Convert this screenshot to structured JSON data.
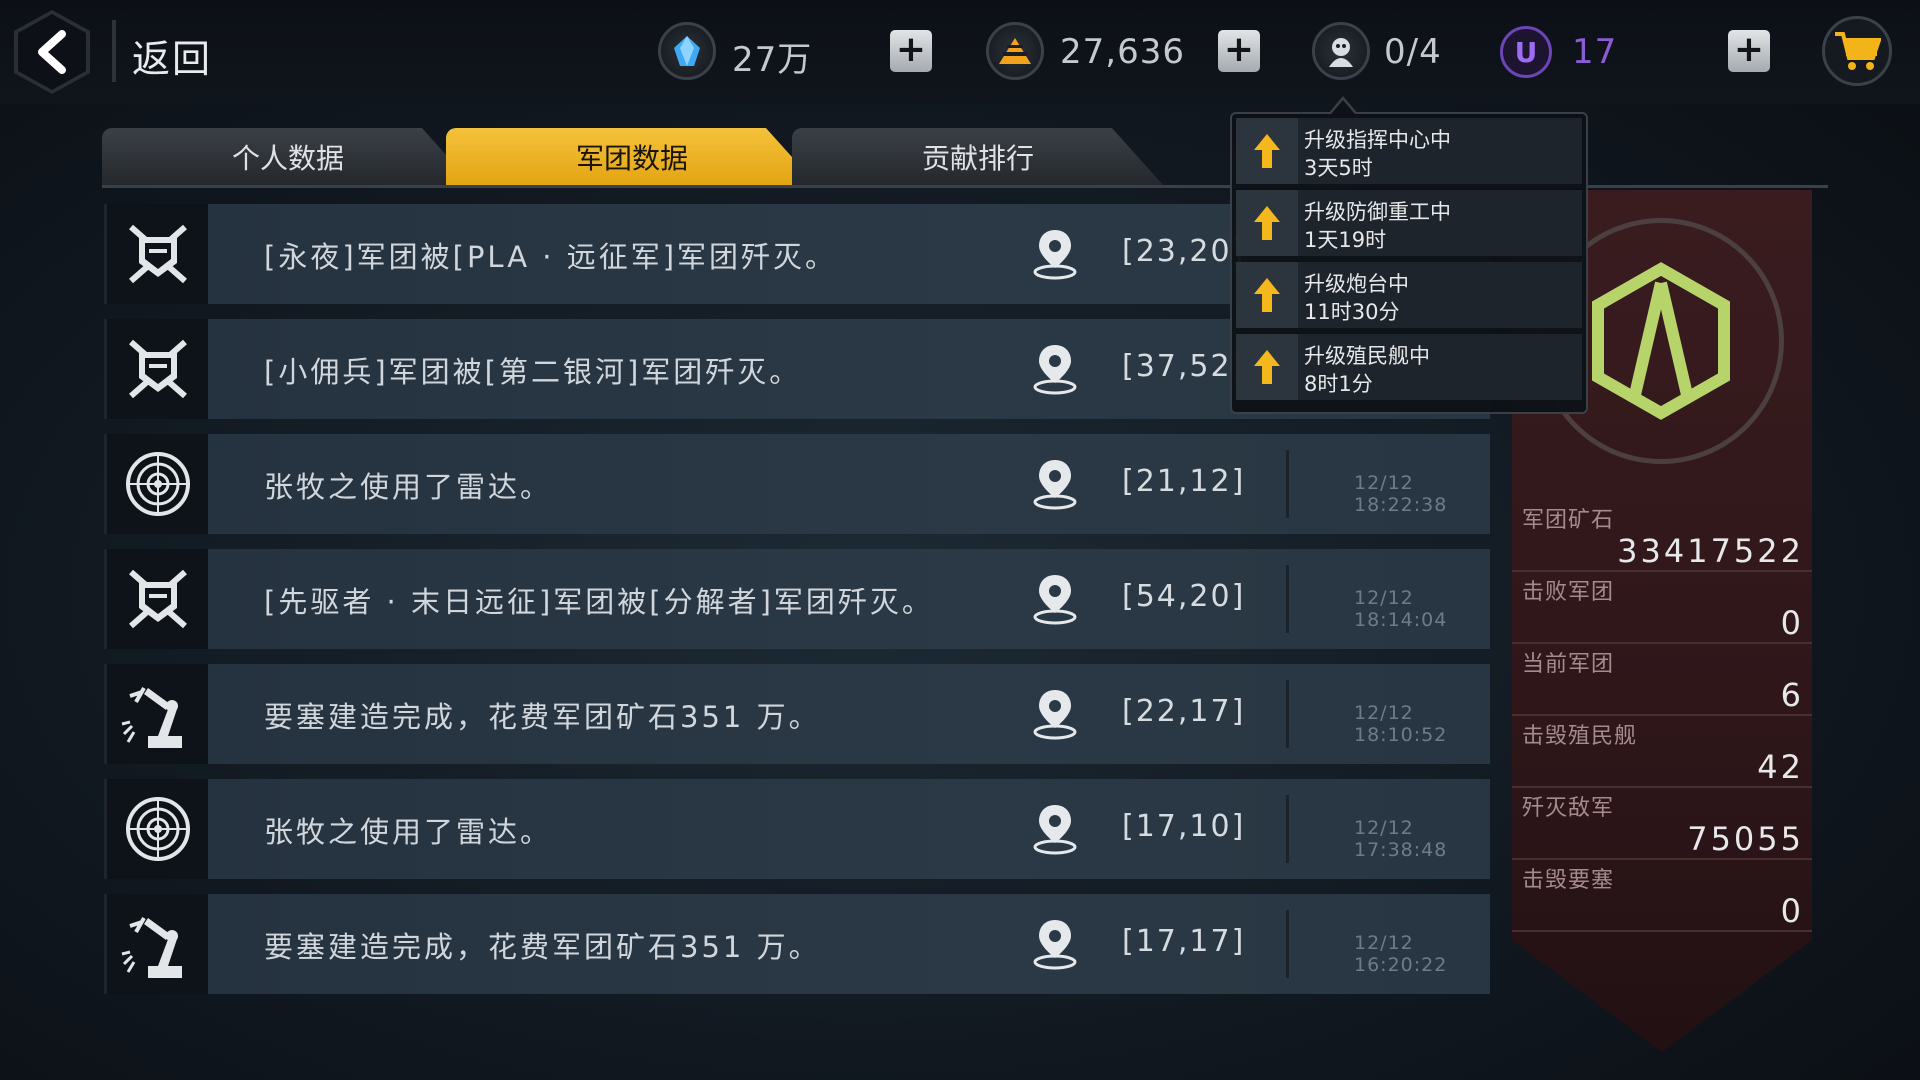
{
  "colors": {
    "accent": "#f0b42a",
    "panel": "#2c1518",
    "emblem": "#b7d46b",
    "purple": "#8a5cd6"
  },
  "header": {
    "back_label": "返回",
    "crystal": "27万",
    "ore": "27,636",
    "troops": "0/4",
    "u_value": "17"
  },
  "tabs": [
    {
      "label": "个人数据",
      "active": false
    },
    {
      "label": "军团数据",
      "active": true
    },
    {
      "label": "贡献排行",
      "active": false
    }
  ],
  "logs": [
    {
      "icon": "skull-shield-icon",
      "text": "[永夜]军团被[PLA · 远征军]军团歼灭。",
      "coord": "[23,20]",
      "time": ""
    },
    {
      "icon": "skull-shield-icon",
      "text": "[小佣兵]军团被[第二银河]军团歼灭。",
      "coord": "[37,52]",
      "time": ""
    },
    {
      "icon": "radar-icon",
      "text": "张牧之使用了雷达。",
      "coord": "[21,12]",
      "time": "12/12 18:22:38"
    },
    {
      "icon": "skull-shield-icon",
      "text": "[先驱者 · 末日远征]军团被[分解者]军团歼灭。",
      "coord": "[54,20]",
      "time": "12/12 18:14:04"
    },
    {
      "icon": "robot-arm-icon",
      "text": "要塞建造完成，花费军团矿石351 万。",
      "coord": "[22,17]",
      "time": "12/12 18:10:52"
    },
    {
      "icon": "radar-icon",
      "text": "张牧之使用了雷达。",
      "coord": "[17,10]",
      "time": "12/12 17:38:48"
    },
    {
      "icon": "robot-arm-icon",
      "text": "要塞建造完成，花费军团矿石351 万。",
      "coord": "[17,17]",
      "time": "12/12 16:20:22"
    }
  ],
  "stats": [
    {
      "label": "军团矿石",
      "value": "33417522"
    },
    {
      "label": "击败军团",
      "value": "0"
    },
    {
      "label": "当前军团",
      "value": "6"
    },
    {
      "label": "击毁殖民舰",
      "value": "42"
    },
    {
      "label": "歼灭敌军",
      "value": "75055"
    },
    {
      "label": "击毁要塞",
      "value": "0"
    }
  ],
  "tasks": [
    {
      "title": "升级指挥中心中",
      "time": "3天5时"
    },
    {
      "title": "升级防御重工中",
      "time": "1天19时"
    },
    {
      "title": "升级炮台中",
      "time": "11时30分"
    },
    {
      "title": "升级殖民舰中",
      "time": "8时1分"
    }
  ]
}
